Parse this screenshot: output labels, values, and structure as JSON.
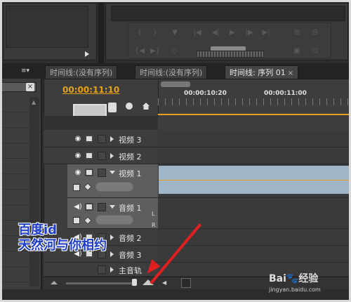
{
  "tabs": [
    {
      "label": "时间线:(没有序列)"
    },
    {
      "label": "时间线:(没有序列)"
    },
    {
      "label": "时间线: 序列 01",
      "close": "×"
    }
  ],
  "project_panel": {
    "menu_icon": "≡▾",
    "clear_label": "×"
  },
  "timeline": {
    "timecode": "00:00:11:10",
    "ruler_labels": [
      "00:00:10:20",
      "00:00:11:00"
    ],
    "tracks": [
      {
        "name": "视频 3",
        "kind": "video"
      },
      {
        "name": "视频 2",
        "kind": "video"
      },
      {
        "name": "视频 1",
        "kind": "video",
        "expanded": true
      },
      {
        "name": "音频 1",
        "kind": "audio",
        "expanded": true
      },
      {
        "name": "音频 2",
        "kind": "audio"
      },
      {
        "name": "音频 3",
        "kind": "audio"
      },
      {
        "name": "主音轨",
        "kind": "master"
      }
    ],
    "lr": {
      "l": "L",
      "r": "R"
    }
  },
  "overlay": {
    "line1": "百度id",
    "line2": "天然河与你相约",
    "brand": "Bai",
    "brand_suffix": "经验",
    "url": "jingyan.baidu.com"
  },
  "colors": {
    "timecode": "#e6a21a",
    "clip": "#9fb6c9",
    "overlay_text": "#1d3cc7",
    "arrow": "#e02020"
  }
}
